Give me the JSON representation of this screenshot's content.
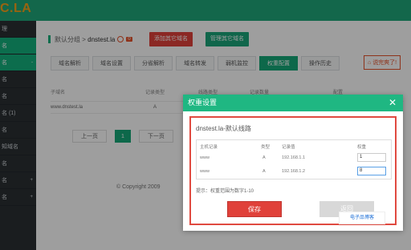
{
  "logo": "C.LA",
  "sidebar": {
    "items": [
      {
        "label": "理"
      },
      {
        "label": "名"
      },
      {
        "label": "名",
        "arrow": "-"
      },
      {
        "label": "名"
      },
      {
        "label": "名"
      },
      {
        "label": "名 (1)"
      },
      {
        "label": "名"
      },
      {
        "label": "知域名"
      },
      {
        "label": "名"
      },
      {
        "label": "名",
        "arrow": "+"
      },
      {
        "label": "名",
        "arrow": "+"
      }
    ]
  },
  "header": {
    "breadcrumb_prefix": "默认分组",
    "breadcrumb_sep": ">",
    "domain": "dnstest.la",
    "badge": "0",
    "add_other_domain": "添加其它域名",
    "manage_other_domain": "管理其它域名"
  },
  "tabs": [
    {
      "label": "域名解析"
    },
    {
      "label": "域名设置"
    },
    {
      "label": "分省解析"
    },
    {
      "label": "域名转发"
    },
    {
      "label": "弱机监控"
    },
    {
      "label": "权重配置",
      "active": true
    },
    {
      "label": "操作历史"
    }
  ],
  "hot_button": "说完爽了!",
  "table": {
    "headers": [
      "子域名",
      "记录类型",
      "线路类型",
      "记录数量",
      "配置"
    ],
    "row": {
      "host": "www.dnstest.la",
      "type": "A"
    }
  },
  "pager": {
    "prev": "上一页",
    "current": "1",
    "next": "下一页"
  },
  "copyright": "© Copyright 2009",
  "modal": {
    "title": "权重设置",
    "close": "✕",
    "subtitle": "dnstest.la-默认线路",
    "columns": [
      "主机记录",
      "类型",
      "记录值",
      "权重"
    ],
    "rows": [
      {
        "host": "www",
        "type": "A",
        "value": "192.168.1.1",
        "weight": "1"
      },
      {
        "host": "www",
        "type": "A",
        "value": "192.168.1.2",
        "weight": "8"
      }
    ],
    "tip": "提示：权重范围为数字1-10",
    "save": "保存",
    "back": "返回"
  },
  "watermark": "电子品博客"
}
